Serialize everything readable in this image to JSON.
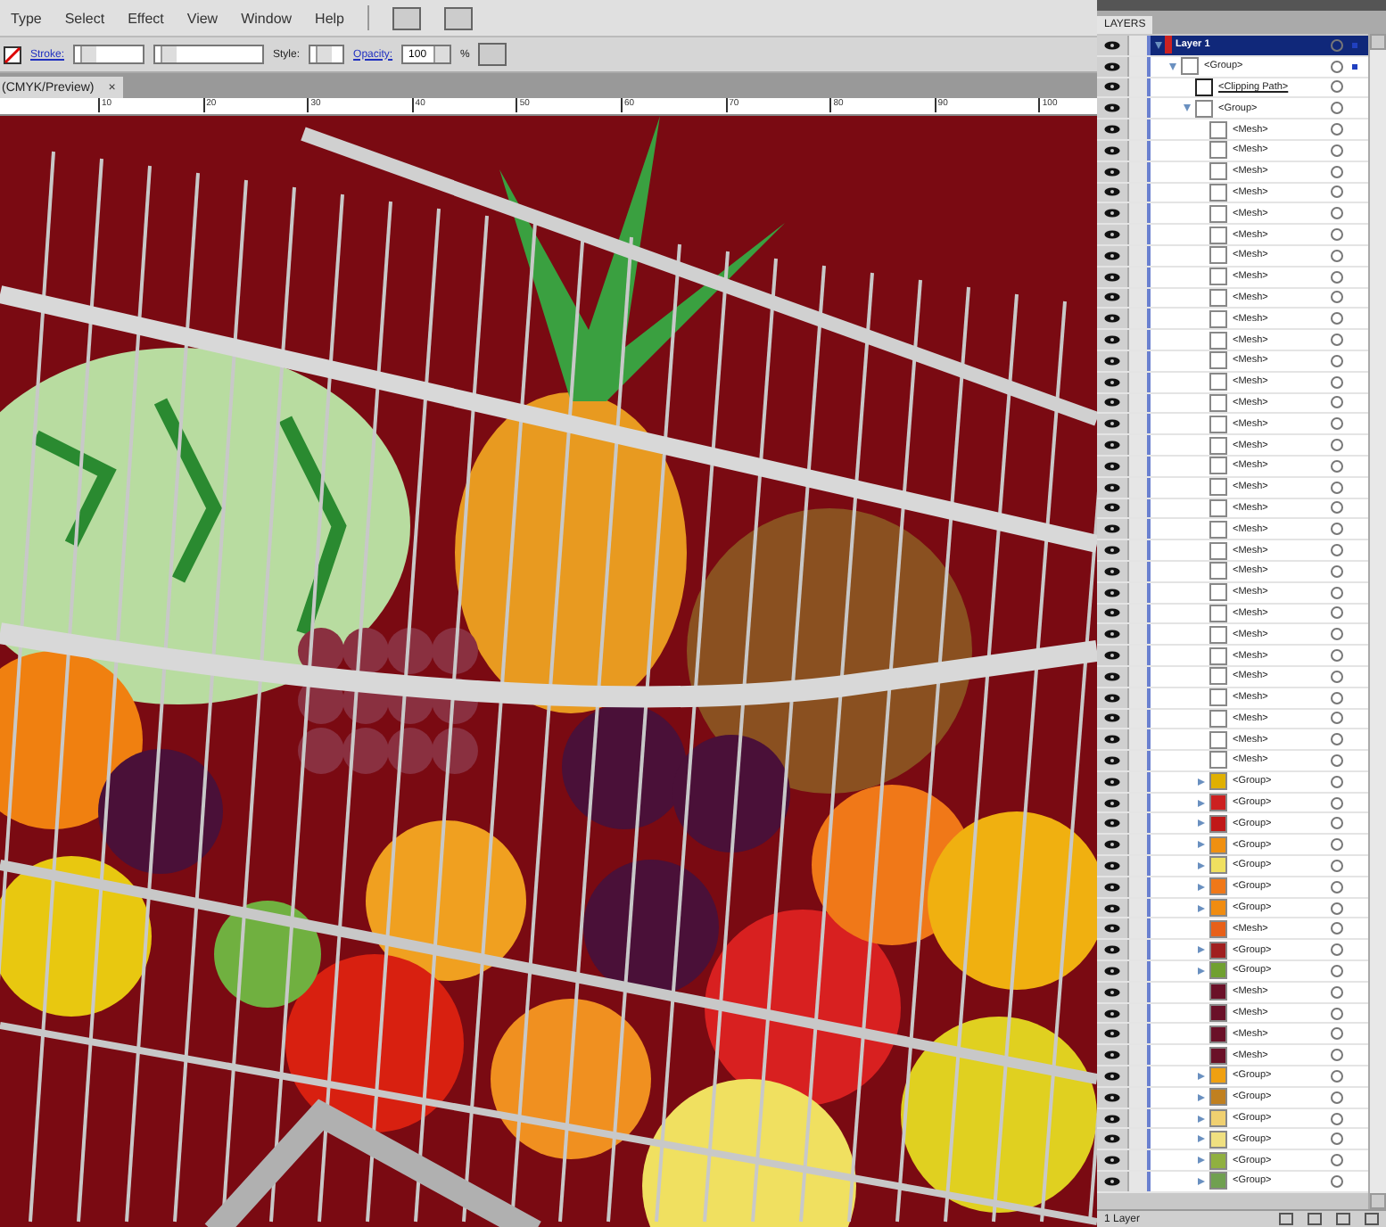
{
  "menu": [
    "Type",
    "Select",
    "Effect",
    "View",
    "Window",
    "Help"
  ],
  "control_bar": {
    "stroke_label": "Stroke:",
    "style_label": "Style:",
    "opacity_label": "Opacity:",
    "opacity_value": "100",
    "percent": "%"
  },
  "document_tab": {
    "title": "(CMYK/Preview)",
    "close": "×"
  },
  "ruler": [
    "10",
    "20",
    "30",
    "40",
    "50",
    "60",
    "70",
    "80",
    "90",
    "100"
  ],
  "layers_panel": {
    "tab": "LAYERS",
    "status": "1 Layer",
    "items": [
      {
        "name": "Layer 1",
        "selected": true,
        "expanded": true,
        "color": "#cc2222",
        "children": [
          {
            "name": "<Group>",
            "selected": false,
            "expanded": true,
            "children": [
              {
                "name": "<Clipping Path>",
                "kind": "clip",
                "selected": false
              },
              {
                "name": "<Group>",
                "selected": false,
                "expanded": true,
                "children": [
                  {
                    "name": "<Mesh>",
                    "kind": "mesh",
                    "selected": false
                  },
                  {
                    "name": "<Mesh>",
                    "kind": "mesh",
                    "selected": false
                  },
                  {
                    "name": "<Mesh>",
                    "kind": "mesh",
                    "selected": false
                  },
                  {
                    "name": "<Mesh>",
                    "kind": "mesh",
                    "selected": false
                  },
                  {
                    "name": "<Mesh>",
                    "kind": "mesh",
                    "selected": false
                  },
                  {
                    "name": "<Mesh>",
                    "kind": "mesh",
                    "selected": false
                  },
                  {
                    "name": "<Mesh>",
                    "kind": "mesh",
                    "selected": false
                  },
                  {
                    "name": "<Mesh>",
                    "kind": "mesh",
                    "selected": false
                  },
                  {
                    "name": "<Mesh>",
                    "kind": "mesh",
                    "selected": false
                  },
                  {
                    "name": "<Mesh>",
                    "kind": "mesh",
                    "selected": false
                  },
                  {
                    "name": "<Mesh>",
                    "kind": "mesh",
                    "selected": false
                  },
                  {
                    "name": "<Mesh>",
                    "kind": "mesh",
                    "selected": false
                  },
                  {
                    "name": "<Mesh>",
                    "kind": "mesh",
                    "selected": false
                  },
                  {
                    "name": "<Mesh>",
                    "kind": "mesh",
                    "selected": false
                  },
                  {
                    "name": "<Mesh>",
                    "kind": "mesh",
                    "selected": false
                  },
                  {
                    "name": "<Mesh>",
                    "kind": "mesh",
                    "selected": false
                  },
                  {
                    "name": "<Mesh>",
                    "kind": "mesh",
                    "selected": false
                  },
                  {
                    "name": "<Mesh>",
                    "kind": "mesh",
                    "selected": false
                  },
                  {
                    "name": "<Mesh>",
                    "kind": "mesh",
                    "selected": false
                  },
                  {
                    "name": "<Mesh>",
                    "kind": "mesh",
                    "selected": false
                  },
                  {
                    "name": "<Mesh>",
                    "kind": "mesh",
                    "selected": false
                  },
                  {
                    "name": "<Mesh>",
                    "kind": "mesh",
                    "selected": false
                  },
                  {
                    "name": "<Mesh>",
                    "kind": "mesh",
                    "selected": false
                  },
                  {
                    "name": "<Mesh>",
                    "kind": "mesh",
                    "selected": false
                  },
                  {
                    "name": "<Mesh>",
                    "kind": "mesh",
                    "selected": false
                  },
                  {
                    "name": "<Mesh>",
                    "kind": "mesh",
                    "selected": false
                  },
                  {
                    "name": "<Mesh>",
                    "kind": "mesh",
                    "selected": false
                  },
                  {
                    "name": "<Mesh>",
                    "kind": "mesh",
                    "selected": false
                  },
                  {
                    "name": "<Mesh>",
                    "kind": "mesh",
                    "selected": false
                  },
                  {
                    "name": "<Mesh>",
                    "kind": "mesh",
                    "selected": false
                  },
                  {
                    "name": "<Mesh>",
                    "kind": "mesh",
                    "selected": false
                  },
                  {
                    "name": "<Group>",
                    "selected": false,
                    "expanded": false,
                    "color": "#e0b000"
                  },
                  {
                    "name": "<Group>",
                    "selected": false,
                    "expanded": false,
                    "color": "#cc2020"
                  },
                  {
                    "name": "<Group>",
                    "selected": false,
                    "expanded": false,
                    "color": "#c01818"
                  },
                  {
                    "name": "<Group>",
                    "selected": false,
                    "expanded": false,
                    "color": "#f09010"
                  },
                  {
                    "name": "<Group>",
                    "selected": false,
                    "expanded": false,
                    "color": "#f0e060"
                  },
                  {
                    "name": "<Group>",
                    "selected": false,
                    "expanded": false,
                    "color": "#f07818"
                  },
                  {
                    "name": "<Group>",
                    "selected": false,
                    "expanded": false,
                    "color": "#f08c10"
                  },
                  {
                    "name": "<Mesh>",
                    "kind": "mesh",
                    "selected": false,
                    "color": "#e86018"
                  },
                  {
                    "name": "<Group>",
                    "selected": false,
                    "expanded": false,
                    "color": "#a02020"
                  },
                  {
                    "name": "<Group>",
                    "selected": false,
                    "expanded": false,
                    "color": "#70a030"
                  },
                  {
                    "name": "<Mesh>",
                    "kind": "mesh",
                    "selected": false,
                    "color": "#6a1028"
                  },
                  {
                    "name": "<Mesh>",
                    "kind": "mesh",
                    "selected": false,
                    "color": "#6a1028"
                  },
                  {
                    "name": "<Mesh>",
                    "kind": "mesh",
                    "selected": false,
                    "color": "#6a1028"
                  },
                  {
                    "name": "<Mesh>",
                    "kind": "mesh",
                    "selected": false,
                    "color": "#6a1028"
                  },
                  {
                    "name": "<Group>",
                    "selected": false,
                    "expanded": false,
                    "color": "#f0a010"
                  },
                  {
                    "name": "<Group>",
                    "selected": false,
                    "expanded": false,
                    "color": "#c08020"
                  },
                  {
                    "name": "<Group>",
                    "selected": false,
                    "expanded": false,
                    "color": "#f0d070"
                  },
                  {
                    "name": "<Group>",
                    "selected": false,
                    "expanded": false,
                    "color": "#f0e080"
                  },
                  {
                    "name": "<Group>",
                    "selected": false,
                    "expanded": false,
                    "color": "#90b040"
                  },
                  {
                    "name": "<Group>",
                    "selected": false,
                    "expanded": false,
                    "color": "#70a050"
                  }
                ]
              }
            ]
          }
        ]
      }
    ]
  }
}
